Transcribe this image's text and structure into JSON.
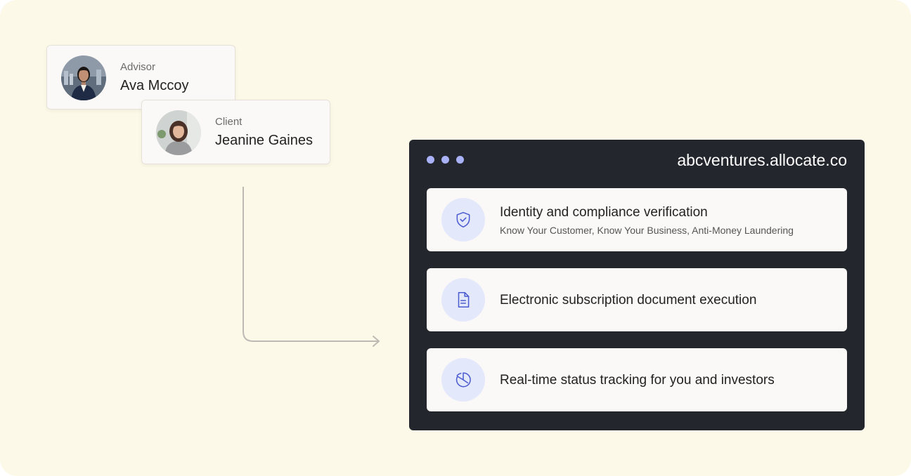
{
  "advisor": {
    "role": "Advisor",
    "name": "Ava Mccoy",
    "avatar_icon": "advisor-avatar"
  },
  "client": {
    "role": "Client",
    "name": "Jeanine Gaines",
    "avatar_icon": "client-avatar"
  },
  "browser": {
    "url": "abcventures.allocate.co",
    "features": [
      {
        "icon": "shield-check-icon",
        "title": "Identity and compliance verification",
        "subtitle": "Know Your Customer, Know Your Business, Anti-Money Laundering"
      },
      {
        "icon": "document-icon",
        "title": "Electronic subscription document execution"
      },
      {
        "icon": "pie-chart-icon",
        "title": "Real-time status tracking for you and investors"
      }
    ]
  },
  "colors": {
    "background": "#fdf9e8",
    "browser_dark": "#23262c",
    "dot_accent": "#aab2f7",
    "icon_circle": "#e4e8fb",
    "icon_stroke": "#4b5bd0"
  }
}
